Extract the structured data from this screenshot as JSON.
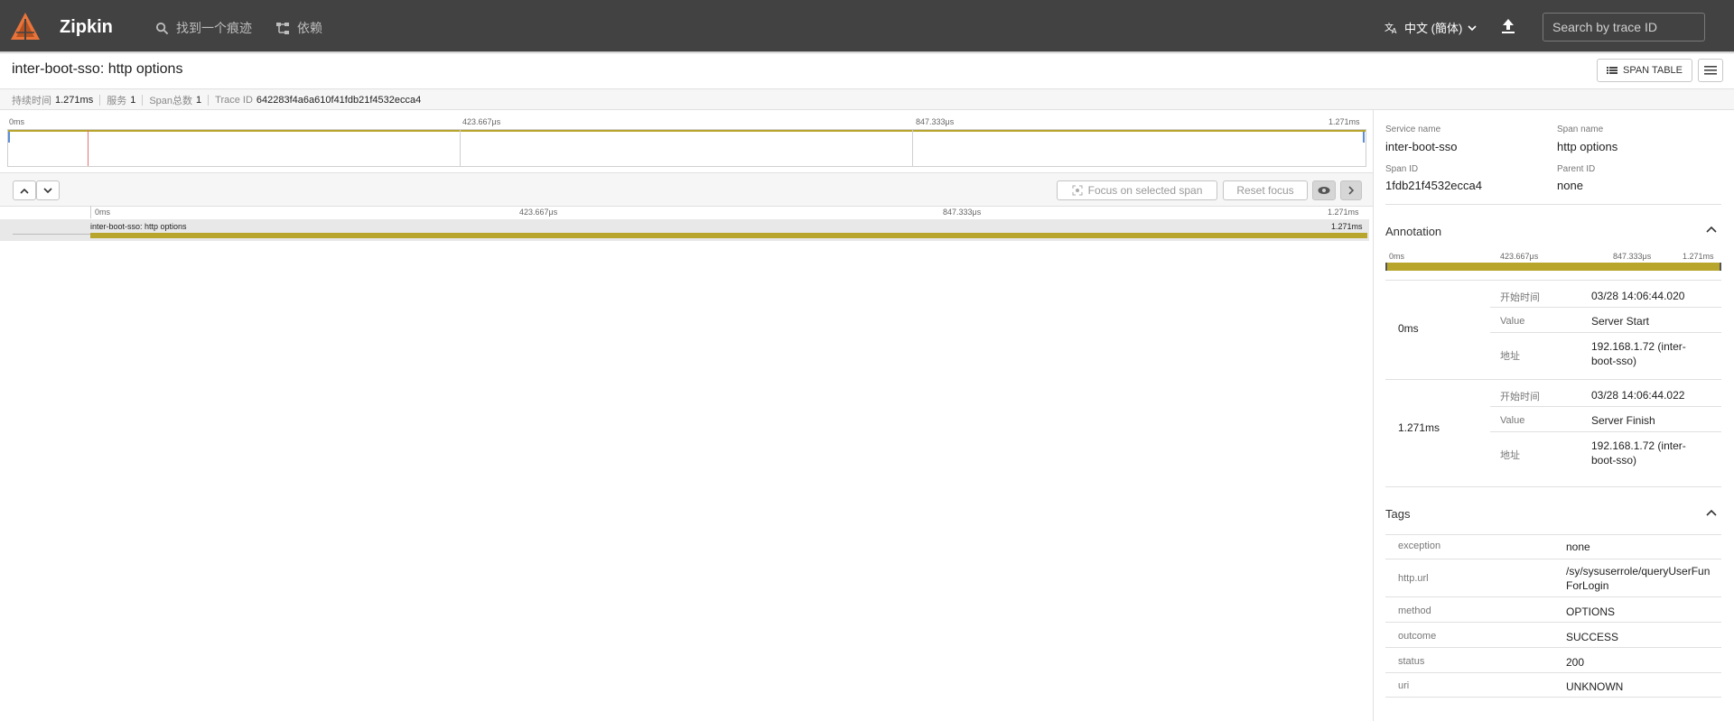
{
  "app": {
    "brand": "Zipkin",
    "nav_find_trace": "找到一个痕迹",
    "nav_dependencies": "依赖",
    "language": "中文 (簡体)",
    "search_placeholder": "Search by trace ID"
  },
  "trace": {
    "title": "inter-boot-sso: http options",
    "span_table_label": "SPAN TABLE",
    "stats": [
      {
        "label": "持续时间",
        "value": "1.271ms"
      },
      {
        "label": "服务",
        "value": "1"
      },
      {
        "label": "Span总数",
        "value": "1"
      },
      {
        "label": "Trace ID",
        "value": "642283f4a6a610f41fdb21f4532ecca4"
      }
    ]
  },
  "minimap": {
    "ticks": [
      "0ms",
      "423.667μs",
      "847.333μs",
      "1.271ms"
    ]
  },
  "controls": {
    "focus_label": "Focus on selected span",
    "reset_label": "Reset focus"
  },
  "timeline": {
    "ticks": [
      "0ms",
      "423.667μs",
      "847.333μs",
      "1.271ms"
    ],
    "span": {
      "name": "inter-boot-sso: http options",
      "duration": "1.271ms",
      "fraction": 1.0
    }
  },
  "detail": {
    "service_name_label": "Service name",
    "service_name": "inter-boot-sso",
    "span_name_label": "Span name",
    "span_name": "http options",
    "span_id_label": "Span ID",
    "span_id": "1fdb21f4532ecca4",
    "parent_id_label": "Parent ID",
    "parent_id": "none",
    "annotation_title": "Annotation",
    "annotation_ticks": [
      "0ms",
      "423.667μs",
      "847.333μs",
      "1.271ms"
    ],
    "annotations": [
      {
        "time": "0ms",
        "rows": [
          {
            "k": "开始时间",
            "v": "03/28 14:06:44.020"
          },
          {
            "k": "Value",
            "v": "Server Start"
          },
          {
            "k": "地址",
            "v": "192.168.1.72 (inter-boot-sso)"
          }
        ]
      },
      {
        "time": "1.271ms",
        "rows": [
          {
            "k": "开始时间",
            "v": "03/28 14:06:44.022"
          },
          {
            "k": "Value",
            "v": "Server Finish"
          },
          {
            "k": "地址",
            "v": "192.168.1.72 (inter-boot-sso)"
          }
        ]
      }
    ],
    "tags_title": "Tags",
    "tags": [
      {
        "k": "exception",
        "v": "none"
      },
      {
        "k": "http.url",
        "v": "/sy/sysuserrole/queryUserFunForLogin"
      },
      {
        "k": "method",
        "v": "OPTIONS"
      },
      {
        "k": "outcome",
        "v": "SUCCESS"
      },
      {
        "k": "status",
        "v": "200"
      },
      {
        "k": "uri",
        "v": "UNKNOWN"
      }
    ]
  },
  "colors": {
    "topbar": "#424242",
    "span_bar": "#b8a52c",
    "cursor": "#e57373",
    "logo": "#e8743b"
  }
}
